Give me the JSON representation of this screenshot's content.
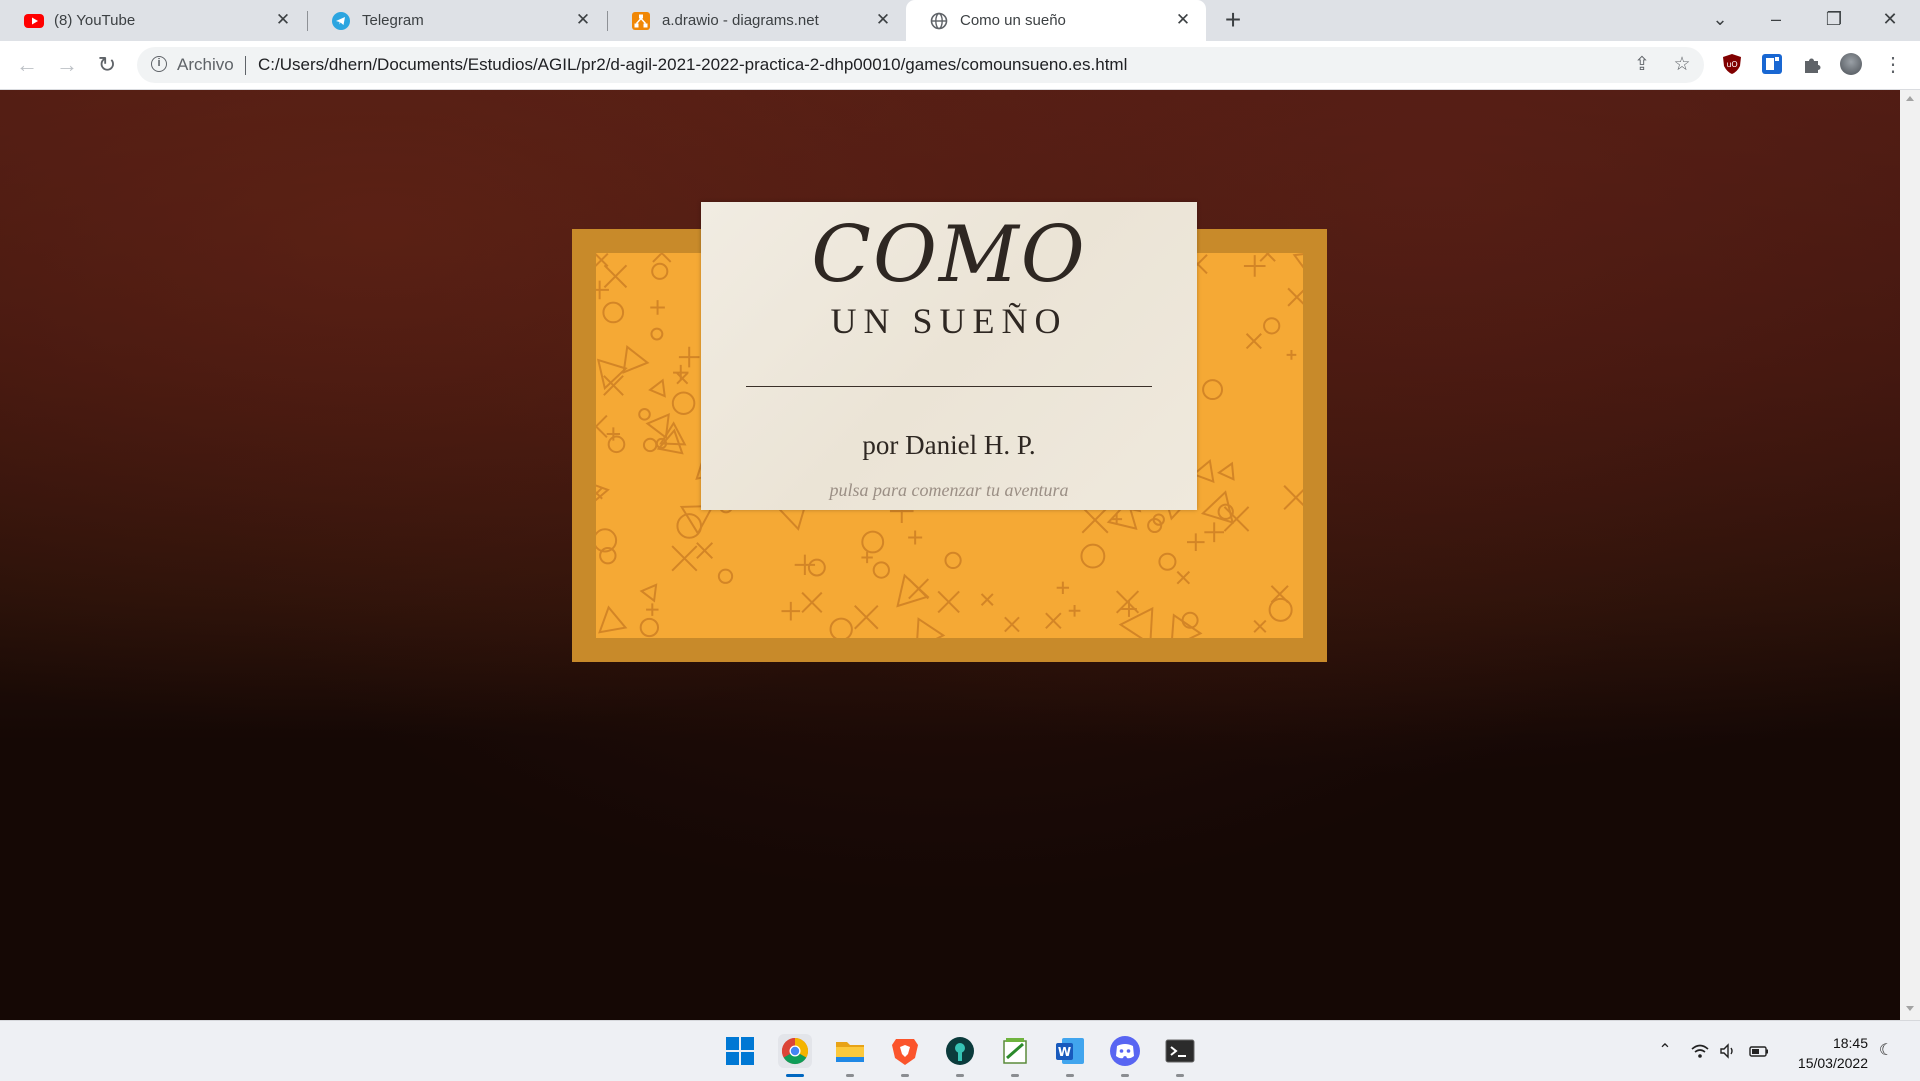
{
  "browser": {
    "tabs": [
      {
        "title": "(8) YouTube",
        "icon": "youtube-icon"
      },
      {
        "title": "Telegram",
        "icon": "telegram-icon"
      },
      {
        "title": "a.drawio - diagrams.net",
        "icon": "drawio-icon"
      },
      {
        "title": "Como un sueño",
        "icon": "globe-icon",
        "active": true
      }
    ],
    "address": {
      "prefix": "Archivo",
      "url": "C:/Users/dhern/Documents/Estudios/AGIL/pr2/d-agil-2021-2022-practica-2-dhp00010/games/comounsueno.es.html"
    }
  },
  "page": {
    "title_main": "COMO",
    "title_sub": "UN SUEÑO",
    "author": "por Daniel H. P.",
    "hint": "pulsa para comenzar tu aventura"
  },
  "taskbar": {
    "apps": [
      "start-icon",
      "chrome-icon",
      "file-explorer-icon",
      "brave-icon",
      "gitkraken-icon",
      "notepad-icon",
      "word-icon",
      "discord-icon",
      "terminal-icon"
    ],
    "time": "18:45",
    "date": "15/03/2022"
  },
  "colors": {
    "frame_outer": "#c88a2a",
    "frame_inner": "#f5a935",
    "card": "#ece6da",
    "background": "#3a140d"
  }
}
